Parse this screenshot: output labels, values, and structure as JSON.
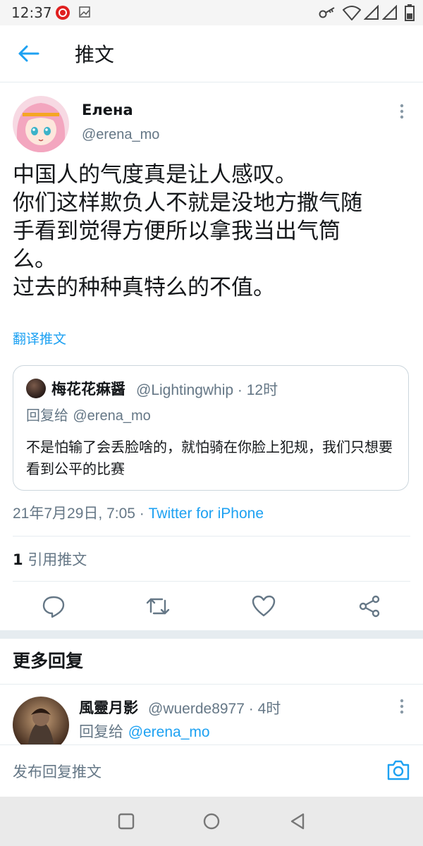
{
  "status_bar": {
    "time": "12:37",
    "icons": [
      "netease-music-icon",
      "gallery-icon",
      "key-icon",
      "wifi-icon",
      "signal-icon",
      "signal-icon",
      "battery-icon"
    ]
  },
  "header": {
    "title": "推文",
    "back_icon": "arrow-left-icon"
  },
  "tweet": {
    "author_name": "Елена",
    "author_handle": "@erena_mo",
    "text": "中国人的气度真是让人感叹。\n你们这样欺负人不就是没地方撒气随\n手看到觉得方便所以拿我当出气筒\n么。\n过去的种种真特么的不值。",
    "translate_label": "翻译推文",
    "quoted": {
      "name": "梅花花痳醤",
      "handle_time": "@Lightingwhip · 12时",
      "reply_prefix": "回复给",
      "reply_to": "@erena_mo",
      "text": "不是怕输了会丢脸啥的，就怕骑在你脸上犯规，我们只想要看到公平的比赛"
    },
    "date": "21年7月29日, 7:05 · ",
    "source": "Twitter for iPhone",
    "quote_count": "1",
    "quote_label": "引用推文"
  },
  "actions": [
    "reply-icon",
    "retweet-icon",
    "like-icon",
    "share-icon"
  ],
  "more_replies": {
    "heading": "更多回复",
    "items": [
      {
        "name": "風靈月影",
        "handle_time": "@wuerde8977 · 4时",
        "reply_prefix": "回复给",
        "reply_to": "@erena_mo"
      }
    ]
  },
  "compose": {
    "placeholder": "发布回复推文"
  },
  "colors": {
    "accent": "#1da1f2",
    "muted": "#657786",
    "text": "#14171a",
    "divider": "#e6ecf0"
  }
}
